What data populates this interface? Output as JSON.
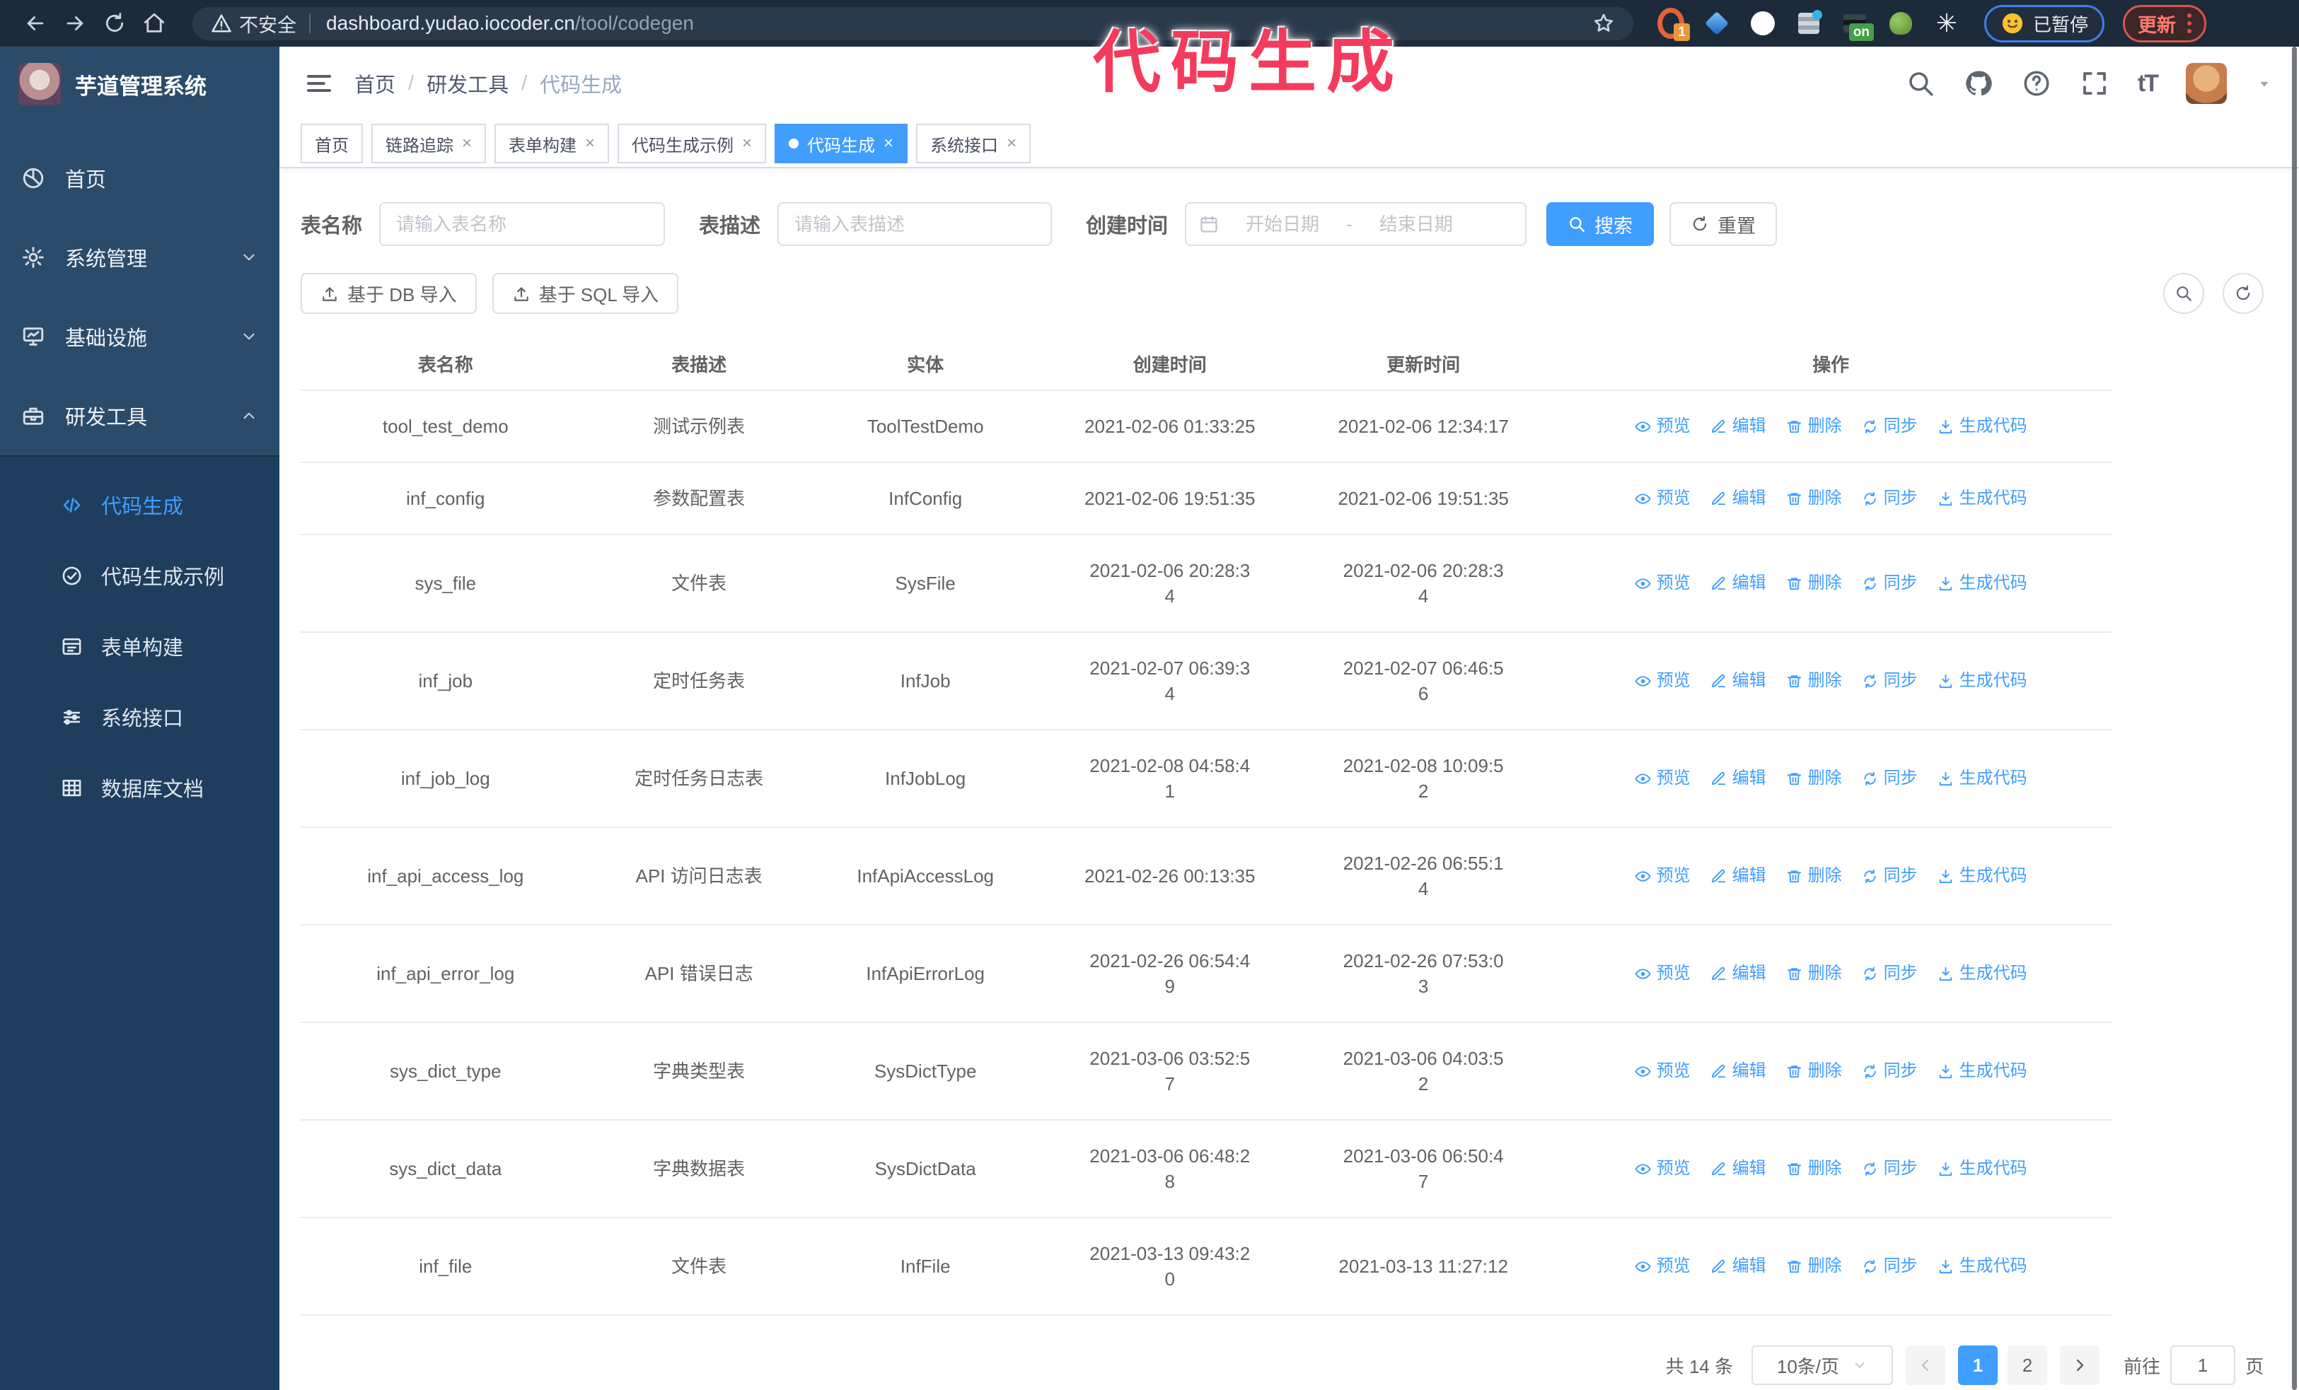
{
  "annotation": {
    "text": "代码生成",
    "color": "#f43b5e"
  },
  "colors": {
    "accent": "#409eff",
    "sidebar_top": "#2b4b6b",
    "sidebar_sub": "#1f3e5e",
    "chrome": "#1d2a39"
  },
  "glyphs": {
    "close": "×",
    "font_size": "tT",
    "asterisk": "✳",
    "range_separator": "-"
  },
  "browser": {
    "security_label": "不安全",
    "url_host": "dashboard.yudao.iocoder.cn",
    "url_path": "/tool/codegen",
    "extensions": [
      {
        "icon": "orange-ring-extension-icon",
        "type": "ring",
        "badge": "1"
      },
      {
        "icon": "blue-gem-extension-icon",
        "type": "gem",
        "badge": ""
      },
      {
        "icon": "green-check-extension-icon",
        "type": "check",
        "badge": ""
      },
      {
        "icon": "sliders-extension-icon",
        "type": "sliders",
        "badge": ""
      },
      {
        "icon": "dark-panel-extension-icon",
        "type": "dark",
        "badge": "on"
      },
      {
        "icon": "green-mascot-extension-icon",
        "type": "mascot",
        "badge": ""
      },
      {
        "icon": "white-asterisk-extension-icon",
        "type": "aster",
        "badge": ""
      }
    ],
    "profile_badge": "已暂停",
    "update_label": "更新"
  },
  "header": {
    "logo_title": "芋道管理系统",
    "breadcrumb": [
      "首页",
      "研发工具",
      "代码生成"
    ],
    "breadcrumb_separator": "/"
  },
  "sidebar": {
    "items": [
      {
        "label": "首页",
        "icon": "home-icon",
        "chevron": ""
      },
      {
        "label": "系统管理",
        "icon": "gear-icon",
        "chevron": "down"
      },
      {
        "label": "基础设施",
        "icon": "monitor-icon",
        "chevron": "down"
      },
      {
        "label": "研发工具",
        "icon": "toolbox-icon",
        "chevron": "up"
      }
    ],
    "submenu": [
      {
        "label": "代码生成",
        "icon": "code-icon",
        "active": true
      },
      {
        "label": "代码生成示例",
        "icon": "example-icon",
        "active": false
      },
      {
        "label": "表单构建",
        "icon": "form-icon",
        "active": false
      },
      {
        "label": "系统接口",
        "icon": "sliders-icon",
        "active": false
      },
      {
        "label": "数据库文档",
        "icon": "database-icon",
        "active": false
      }
    ]
  },
  "tabs": [
    {
      "label": "首页",
      "closable": false,
      "active": false
    },
    {
      "label": "链路追踪",
      "closable": true,
      "active": false
    },
    {
      "label": "表单构建",
      "closable": true,
      "active": false
    },
    {
      "label": "代码生成示例",
      "closable": true,
      "active": false
    },
    {
      "label": "代码生成",
      "closable": true,
      "active": true
    },
    {
      "label": "系统接口",
      "closable": true,
      "active": false
    }
  ],
  "filters": {
    "name_label": "表名称",
    "name_placeholder": "请输入表名称",
    "desc_label": "表描述",
    "desc_placeholder": "请输入表描述",
    "time_label": "创建时间",
    "start_placeholder": "开始日期",
    "end_placeholder": "结束日期",
    "search_label": "搜索",
    "reset_label": "重置"
  },
  "toolbar": {
    "import_db": "基于 DB 导入",
    "import_sql": "基于 SQL 导入"
  },
  "table": {
    "columns": [
      "表名称",
      "表描述",
      "实体",
      "创建时间",
      "更新时间",
      "操作"
    ],
    "actions": [
      {
        "label": "预览",
        "icon": "eye-icon"
      },
      {
        "label": "编辑",
        "icon": "edit-icon"
      },
      {
        "label": "删除",
        "icon": "delete-icon"
      },
      {
        "label": "同步",
        "icon": "sync-icon"
      },
      {
        "label": "生成代码",
        "icon": "download-icon"
      }
    ],
    "rows": [
      {
        "name": "tool_test_demo",
        "desc": "测试示例表",
        "entity": "ToolTestDemo",
        "created": "2021-02-06 01:33:25",
        "updated": "2021-02-06 12:34:17"
      },
      {
        "name": "inf_config",
        "desc": "参数配置表",
        "entity": "InfConfig",
        "created": "2021-02-06 19:51:35",
        "updated": "2021-02-06 19:51:35"
      },
      {
        "name": "sys_file",
        "desc": "文件表",
        "entity": "SysFile",
        "created": "2021-02-06 20:28:3\n4",
        "updated": "2021-02-06 20:28:3\n4"
      },
      {
        "name": "inf_job",
        "desc": "定时任务表",
        "entity": "InfJob",
        "created": "2021-02-07 06:39:3\n4",
        "updated": "2021-02-07 06:46:5\n6"
      },
      {
        "name": "inf_job_log",
        "desc": "定时任务日志表",
        "entity": "InfJobLog",
        "created": "2021-02-08 04:58:4\n1",
        "updated": "2021-02-08 10:09:5\n2"
      },
      {
        "name": "inf_api_access_log",
        "desc": "API 访问日志表",
        "entity": "InfApiAccessLog",
        "created": "2021-02-26 00:13:35",
        "updated": "2021-02-26 06:55:1\n4"
      },
      {
        "name": "inf_api_error_log",
        "desc": "API 错误日志",
        "entity": "InfApiErrorLog",
        "created": "2021-02-26 06:54:4\n9",
        "updated": "2021-02-26 07:53:0\n3"
      },
      {
        "name": "sys_dict_type",
        "desc": "字典类型表",
        "entity": "SysDictType",
        "created": "2021-03-06 03:52:5\n7",
        "updated": "2021-03-06 04:03:5\n2"
      },
      {
        "name": "sys_dict_data",
        "desc": "字典数据表",
        "entity": "SysDictData",
        "created": "2021-03-06 06:48:2\n8",
        "updated": "2021-03-06 06:50:4\n7"
      },
      {
        "name": "inf_file",
        "desc": "文件表",
        "entity": "InfFile",
        "created": "2021-03-13 09:43:2\n0",
        "updated": "2021-03-13 11:27:12"
      }
    ]
  },
  "pagination": {
    "total": "共 14 条",
    "page_size": "10条/页",
    "pages": [
      "1",
      "2"
    ],
    "active_page": "1",
    "goto_label": "前往",
    "goto_value": "1",
    "goto_suffix": "页"
  }
}
